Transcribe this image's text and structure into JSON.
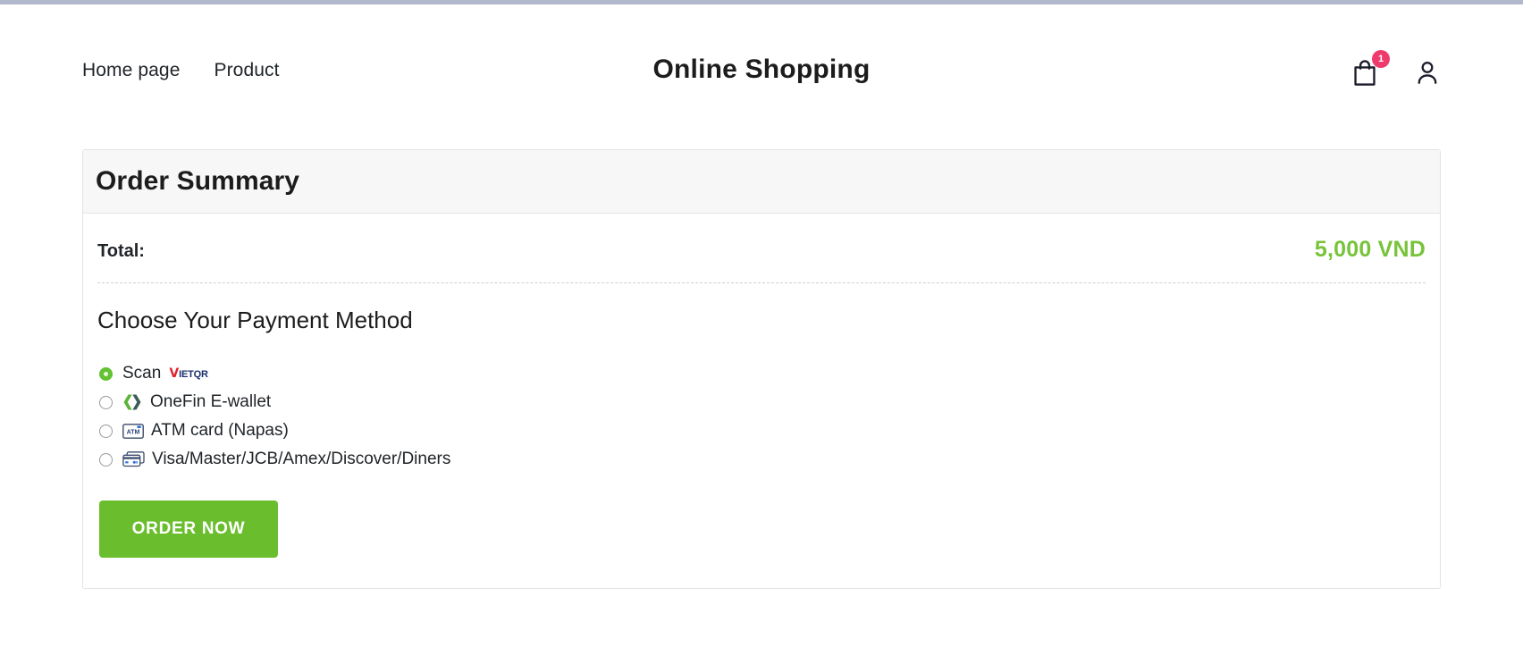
{
  "header": {
    "nav": [
      {
        "label": "Home page"
      },
      {
        "label": "Product"
      }
    ],
    "title": "Online Shopping",
    "cart_icon": "shopping-bag-icon",
    "cart_badge_count": "1",
    "account_icon": "user-account-icon",
    "badge_color": "#ef3a6c"
  },
  "order_summary": {
    "card_title": "Order Summary",
    "total_label": "Total:",
    "total_value": "5,000 VND",
    "total_value_color": "#77c33a",
    "payment_section_title": "Choose Your Payment Method",
    "payment_methods": [
      {
        "label": "Scan",
        "selected": true,
        "logo": "vietqr-logo",
        "logo_text_primary": "V",
        "logo_text_secondary": "IETQR",
        "logo_position": "after"
      },
      {
        "label": "OneFin E-wallet",
        "selected": false,
        "logo": "onefin-chevrons-logo",
        "logo_position": "before"
      },
      {
        "label": "ATM card (Napas)",
        "selected": false,
        "logo": "atm-card-icon",
        "logo_text": "ATM",
        "logo_position": "before"
      },
      {
        "label": "Visa/Master/JCB/Amex/Discover/Diners",
        "selected": false,
        "logo": "credit-cards-icon",
        "logo_position": "before"
      }
    ],
    "order_button_label": "ORDER NOW",
    "order_button_color": "#6abe2d"
  }
}
